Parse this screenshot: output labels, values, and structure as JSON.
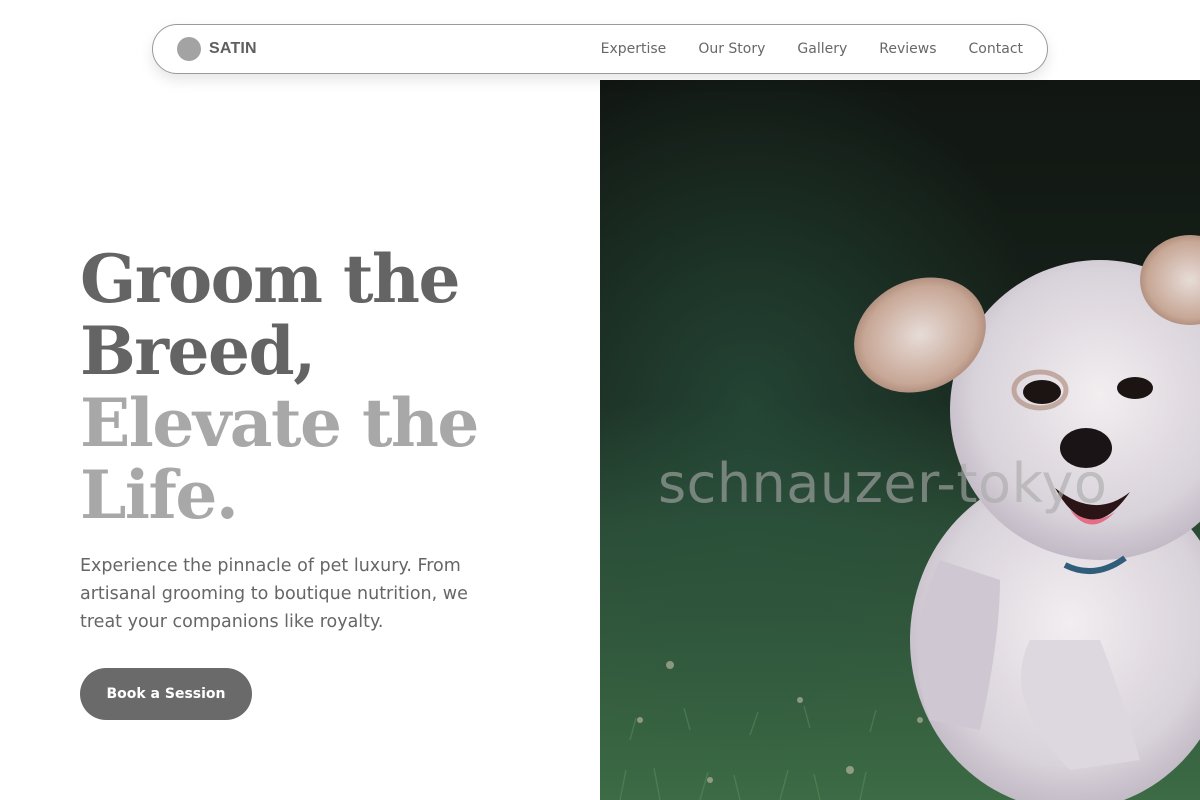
{
  "brand": {
    "name": "SATIN"
  },
  "nav": {
    "links": [
      "Expertise",
      "Our Story",
      "Gallery",
      "Reviews",
      "Contact"
    ]
  },
  "hero": {
    "headline_dark": [
      "Groom the",
      "Breed,"
    ],
    "headline_light": [
      "Elevate the",
      "Life."
    ],
    "subtext": "Experience the pinnacle of pet luxury. From artisanal grooming to boutique nutrition, we treat your companions like royalty.",
    "cta_label": "Book a Session"
  },
  "image": {
    "watermark": "schnauzer-tokyo"
  },
  "colors": {
    "heading_dark": "#646464",
    "heading_light": "#a8a8a8",
    "button_bg": "#6a6a6a",
    "brand_dot": "#a3a3a3"
  }
}
